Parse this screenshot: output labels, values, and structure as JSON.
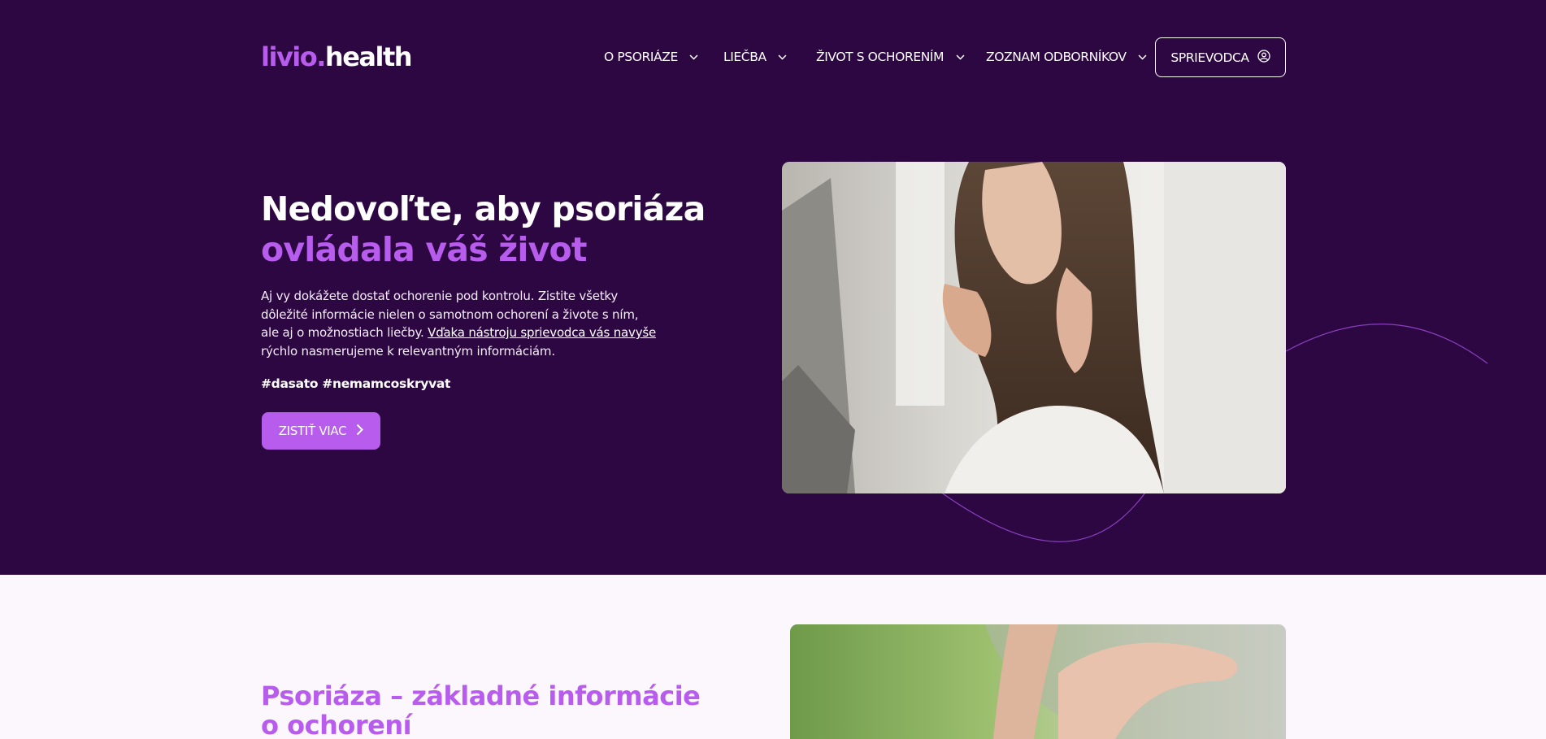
{
  "logo": {
    "part1": "livio.",
    "part2": "health"
  },
  "nav": {
    "items": [
      {
        "label": "O PSORIÁZE"
      },
      {
        "label": "LIEČBA"
      },
      {
        "label": "ŽIVOT S OCHORENÍM"
      },
      {
        "label": "ZOZNAM ODBORNÍKOV"
      }
    ],
    "guide_label": "SPRIEVODCA"
  },
  "hero": {
    "title_line1": "Nedovoľte, aby psoriáza",
    "title_line2": "ovládala váš život",
    "text_before_link": "Aj vy dokážete dostať ochorenie pod kontrolu. Zistite všetky dôležité informácie nielen o samotnom ochorení a živote s ním, ale aj o možnostiach liečby. ",
    "text_link": "Vďaka nástroju sprievodca vás navyše",
    "text_after_link": " rýchlo nasmerujeme k relevantným informáciám.",
    "hashtags": "#dasato #nemamcoskryvat",
    "cta_label": "ZISTIŤ VIAC"
  },
  "section2": {
    "title_line1": "Psoriáza – základné informácie",
    "title_line2": "o ochorení"
  },
  "colors": {
    "hero_bg": "#2d0742",
    "accent": "#b75ced",
    "page_bg": "#fcf6fd"
  },
  "icons": {
    "nav_chevron": "chevron-down-icon",
    "guide_icon": "user-circle-icon",
    "cta_icon": "chevron-right-icon"
  }
}
